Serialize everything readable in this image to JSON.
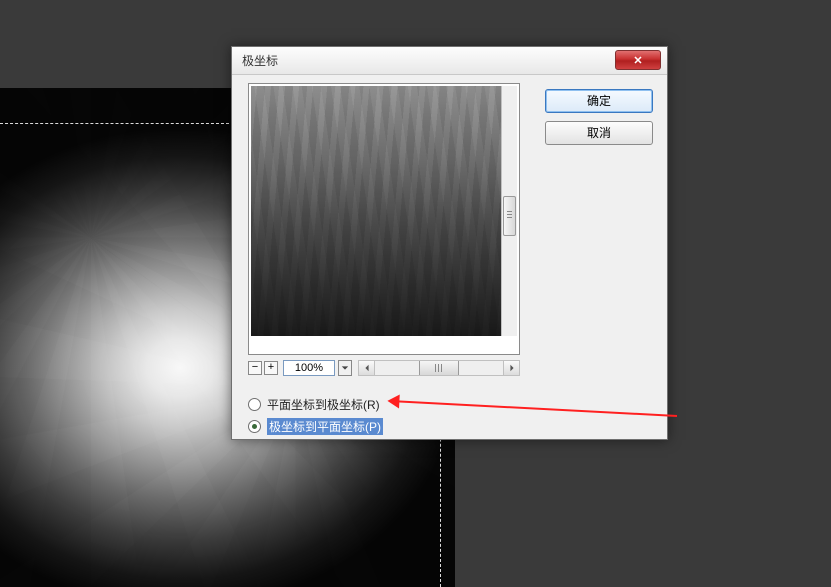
{
  "dialog": {
    "title": "极坐标",
    "close_glyph": "✕",
    "ok_label": "确定",
    "cancel_label": "取消"
  },
  "zoom": {
    "minus": "−",
    "plus": "+",
    "value": "100%"
  },
  "options": {
    "rect_to_polar": "平面坐标到极坐标(R)",
    "polar_to_rect": "极坐标到平面坐标(P)",
    "selected": "polar_to_rect"
  }
}
